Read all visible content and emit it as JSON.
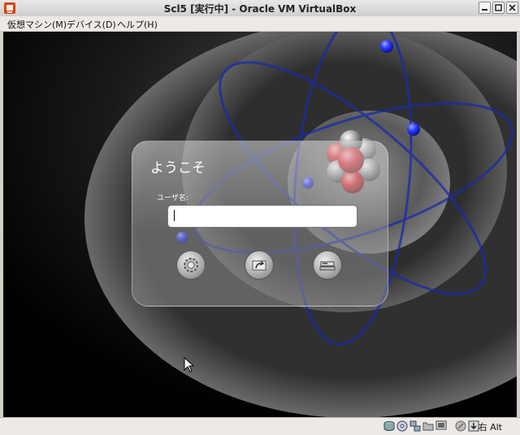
{
  "window": {
    "title": "Scl5 [実行中] - Oracle VM VirtualBox"
  },
  "menu": {
    "items": [
      {
        "label": "仮想マシン(M)"
      },
      {
        "label": "デバイス(D)"
      },
      {
        "label": "ヘルプ(H)"
      }
    ]
  },
  "login": {
    "welcome": "ようこそ",
    "username_label": "ユーザ名:",
    "username_value": ""
  },
  "status": {
    "host_key": "右 Alt"
  },
  "colors": {
    "electron": "#2a3cff",
    "orbit": "#1a2aa8",
    "nucleus_red": "#e0202a"
  }
}
